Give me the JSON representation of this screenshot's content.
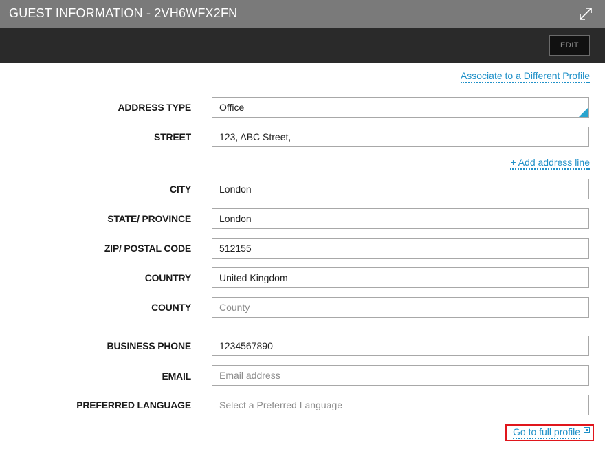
{
  "window": {
    "title": "GUEST INFORMATION - 2VH6WFX2FN",
    "expand_icon": "expand-arrows-icon"
  },
  "toolbar": {
    "edit_label": "EDIT"
  },
  "links": {
    "associate": "Associate to a Different Profile",
    "add_address_line": "+ Add address line",
    "full_profile": "Go to full profile"
  },
  "form": {
    "address_type": {
      "label": "ADDRESS TYPE",
      "value": "Office"
    },
    "street": {
      "label": "STREET",
      "value": "123, ABC Street,"
    },
    "city": {
      "label": "CITY",
      "value": "London"
    },
    "state": {
      "label": "STATE/ PROVINCE",
      "value": "London"
    },
    "zip": {
      "label": "ZIP/ POSTAL CODE",
      "value": "512155"
    },
    "country": {
      "label": "COUNTRY",
      "value": "United Kingdom"
    },
    "county": {
      "label": "COUNTY",
      "value": "",
      "placeholder": "County"
    },
    "business_phone": {
      "label": "BUSINESS PHONE",
      "value": "1234567890"
    },
    "email": {
      "label": "EMAIL",
      "value": "",
      "placeholder": "Email address"
    },
    "preferred_language": {
      "label": "PREFERRED LANGUAGE",
      "value": "",
      "placeholder": "Select a Preferred Language"
    }
  },
  "colors": {
    "title_bar": "#7a7a7a",
    "toolbar": "#2a2a2a",
    "link": "#1e90c8",
    "select_corner": "#2aa5cf",
    "highlight_box": "#e0161c"
  }
}
